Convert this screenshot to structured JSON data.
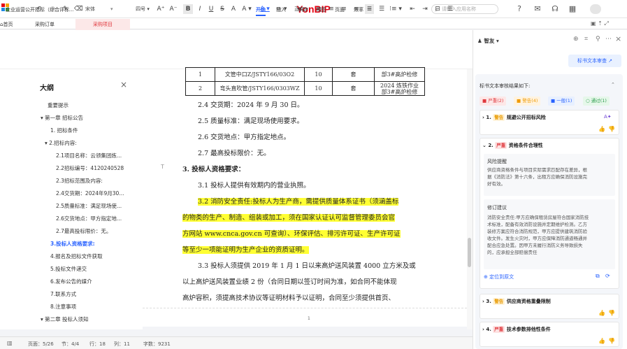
{
  "topbar": {
    "brand": "YonBIP",
    "search_placeholder": "请输入应用名称"
  },
  "tabs": [
    {
      "label": "首页"
    },
    {
      "label": "采购订单"
    },
    {
      "label": "采购项目"
    }
  ],
  "doc": {
    "title": "企业运营公开招标（综合评标...",
    "menus": [
      "开始",
      "插入",
      "审阅",
      "视图",
      "页面",
      "效率"
    ],
    "toolbar": {
      "font": "宋体",
      "size": "四号",
      "style": "正文"
    }
  },
  "outline": {
    "title": "大纲",
    "items": [
      {
        "label": "重要提示"
      },
      {
        "label": "▾ 第一章 招标公告"
      },
      {
        "label": "1. 招标条件"
      },
      {
        "label": "▾ 2.招标内容:"
      },
      {
        "label": "2.1项目名称：云领集团炼..."
      },
      {
        "label": "2.2招标编号：4120240528"
      },
      {
        "label": "2.3招标范围及内容:"
      },
      {
        "label": "2.4交货期：2024年9月30..."
      },
      {
        "label": "2.5质量标准：满足现场使..."
      },
      {
        "label": "2.6交货地点：甲方指定地..."
      },
      {
        "label": "2.7最高投标限价：无。"
      },
      {
        "label": "3.投标人资格要求:"
      },
      {
        "label": "4.报名及招标文件获取"
      },
      {
        "label": "5.投标文件递交"
      },
      {
        "label": "6.发布公告的媒介"
      },
      {
        "label": "7.联系方式"
      },
      {
        "label": "8.注意事项"
      },
      {
        "label": "▾ 第二章 投标人须知"
      }
    ]
  },
  "content": {
    "table": [
      {
        "no": "1",
        "name": "文管中口Z/JSTY166/03O2",
        "qty": "10",
        "unit": "套",
        "note": "部3#高炉检修"
      },
      {
        "no": "2",
        "name": "弯头直吹管/JSTY166/0303WZ",
        "qty": "10",
        "unit": "套",
        "note1": "2024 炼铁作业",
        "note2": "部3#高炉检修"
      }
    ],
    "lines": [
      "2.4 交货期：2024 年 9 月 30 日。",
      "2.5 质量标准：满足现场使用要求。",
      "2.6 交货地点：甲方指定地点。",
      "2.7 最高投标限价：无。",
      "3. 投标人资格要求：",
      "3.1 投标人提供有效期内的营业执照。",
      "3.2 消防安全责任:投标人为生产商，需提供质量体系证书（须涵盖标",
      "的物类的生产、制造、组装或加工，须在国家认证认可监督管理委员会官",
      "方网站 www.cnca.gov.cn 可查询）、环保评估、排污许可证、生产许可证",
      "等至少一项能证明为生产企业的资质证明。",
      "3.3 投标人须提供 2019 年 1 月 1 日以来高炉送风装置 4000 立方米及或",
      "以上高炉送风装置业绩 2 份（合同日期以签订时间为准，如合同不能体现",
      "高炉容积，须提高技术协议等证明材料予以证明，合同至少须提供首页、"
    ],
    "page_num": "1"
  },
  "status": {
    "page": "页面：5/26",
    "section": "节：4/4",
    "row": "行：18",
    "col": "列：11",
    "words": "字数：9231"
  },
  "panel": {
    "agent": "智友",
    "review_btn": "标书文本审查",
    "result_title": "标书文本审核结果如下:",
    "filters": [
      {
        "label": "■ 严重(2)"
      },
      {
        "label": "■ 警告(4)"
      },
      {
        "label": "■ 一般(1)"
      },
      {
        "label": "○ 通过(1)"
      }
    ],
    "items": [
      {
        "num": "1.",
        "tag": "警告",
        "title": "规避公开招标风险"
      },
      {
        "num": "2.",
        "tag": "严重",
        "title": "资格条件合理性",
        "risk_title": "风险提醒",
        "risk_text": [
          "供应商资格条件与项目实际需求匹配存在差异，根",
          "据《消防法》第十六条，出租方应确保消防设施完",
          "好有效。"
        ],
        "fix_title": "修订建议",
        "fix_text": [
          "消防安全责任:甲方应确保租赁房屋符合国家消防技",
          "术标准，配备有效消防设施并定期维护检测。乙方",
          "装修方案应符合消防规范，甲方应提供建筑消防验",
          "收文件。发生火灾时，甲方应保障消防通道畅通并",
          "配合应急处置。因甲方未履行消防义务导致损失",
          "的，应承担全部赔偿责任"
        ],
        "locate": "定位到原文"
      },
      {
        "num": "3.",
        "tag": "警告",
        "title": "供应商资格重叠限制"
      },
      {
        "num": "4.",
        "tag": "严重",
        "title": "技术参数排他性条件"
      }
    ]
  }
}
